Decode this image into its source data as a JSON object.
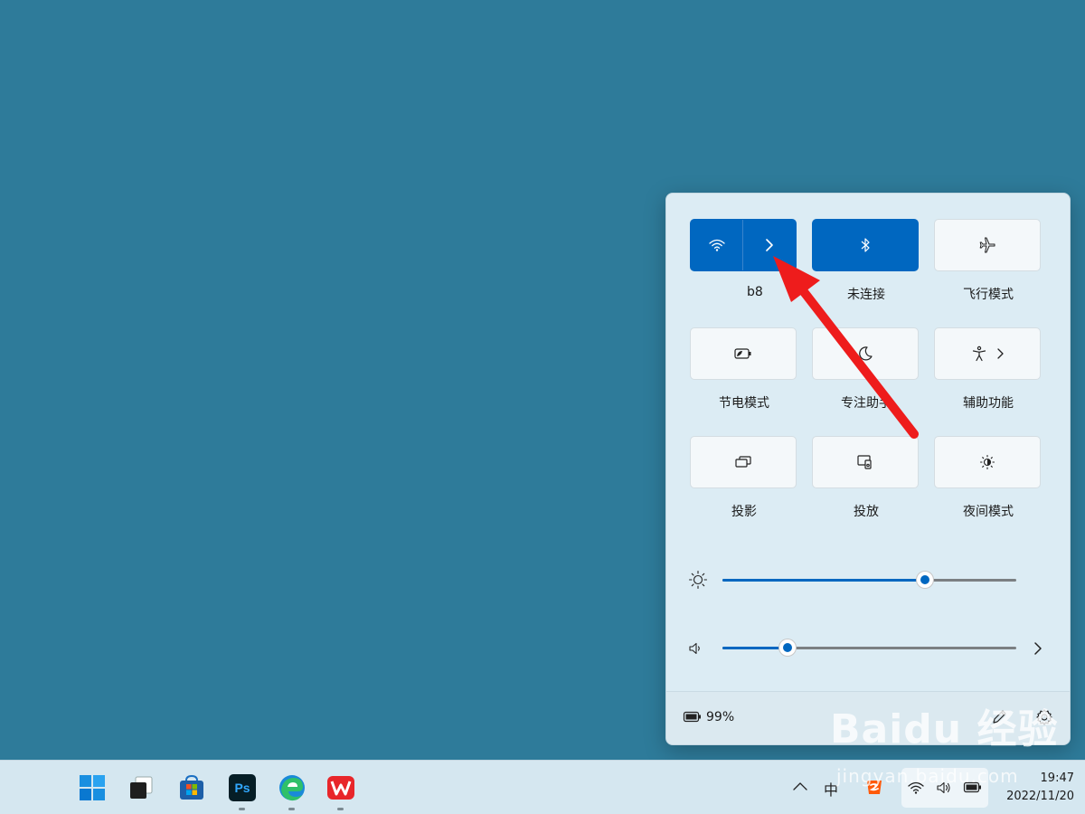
{
  "quick_settings": {
    "tiles": [
      {
        "label": "b8",
        "icon": "wifi-icon",
        "active": true
      },
      {
        "label": "未连接",
        "icon": "bluetooth-icon",
        "active": true
      },
      {
        "label": "飞行模式",
        "icon": "airplane-icon",
        "active": false
      },
      {
        "label": "节电模式",
        "icon": "battery-saver-icon",
        "active": false
      },
      {
        "label": "专注助手",
        "icon": "moon-icon",
        "active": false
      },
      {
        "label": "辅助功能",
        "icon": "accessibility-icon",
        "active": false
      },
      {
        "label": "投影",
        "icon": "project-icon",
        "active": false
      },
      {
        "label": "投放",
        "icon": "cast-icon",
        "active": false
      },
      {
        "label": "夜间模式",
        "icon": "night-light-icon",
        "active": false
      }
    ],
    "brightness": {
      "value": 0.69,
      "icon": "sun-icon"
    },
    "volume": {
      "value": 0.22,
      "icon": "speaker-icon"
    },
    "battery_text": "99%"
  },
  "taskbar": {
    "apps": [
      "windows-start",
      "task-view",
      "microsoft-store",
      "photoshop",
      "edge",
      "wps"
    ],
    "ps_text": "Ps",
    "ime_text": "中",
    "time": "19:47",
    "date": "2022/11/20"
  },
  "watermark": {
    "logo": "Baidu 经验",
    "url": "jingyan.baidu.com"
  },
  "colors": {
    "accent": "#0067c0",
    "desktop": "#2e7b9a",
    "annotation": "#ee1c1c"
  }
}
